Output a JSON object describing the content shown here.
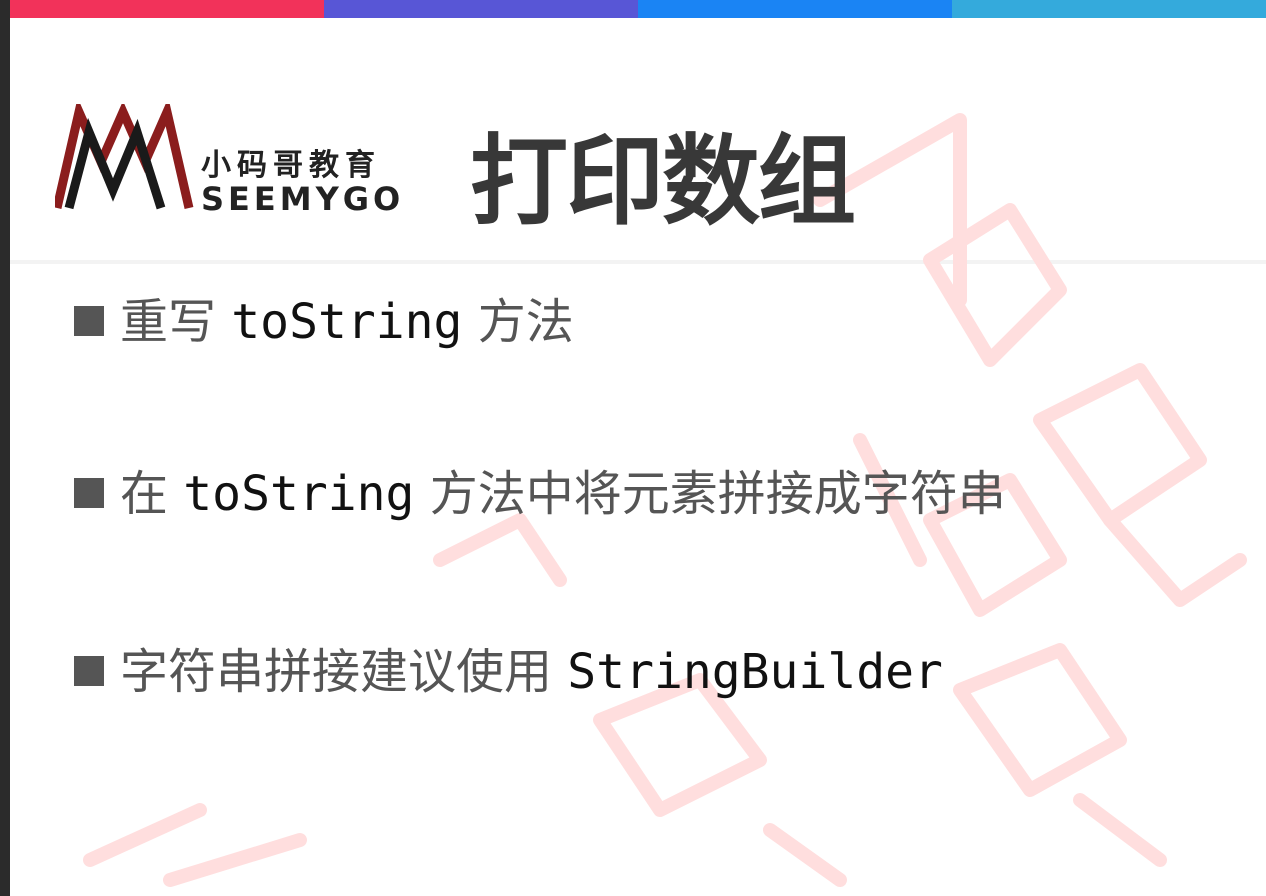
{
  "colors": {
    "bar_red": "#f2325a",
    "bar_purple": "#5856d6",
    "bar_blue": "#1a84f4",
    "bar_teal": "#34aadc",
    "logo_dark_red": "#8b1d1d",
    "logo_black": "#1a1a1a",
    "watermark": "#ffdede",
    "text_gray": "#555555"
  },
  "logo": {
    "chinese": "小码哥教育",
    "english": "SEEMYGO"
  },
  "title": "打印数组",
  "bullets": [
    {
      "before": "重写 ",
      "code": "toString",
      "after": " 方法"
    },
    {
      "before": "在 ",
      "code": "toString",
      "after": " 方法中将元素拼接成字符串"
    },
    {
      "before": "字符串拼接建议使用 ",
      "code": "StringBuilder",
      "after": ""
    }
  ]
}
